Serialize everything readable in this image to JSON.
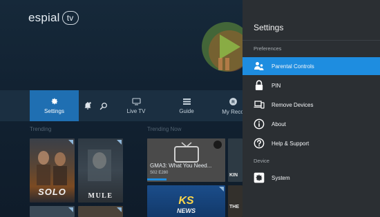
{
  "app": {
    "logo_text": "espial",
    "logo_badge": "tv"
  },
  "nav": {
    "settings_label": "Settings",
    "live_tv_label": "Live TV",
    "guide_label": "Guide",
    "recordings_label": "My Reco"
  },
  "rows": {
    "trending_label": "Trending",
    "trending_now_label": "Trending Now"
  },
  "tiles": {
    "solo_title": "SOLO",
    "mule_title": "MULE",
    "news_title": "GMA3: What You Need...",
    "news_sub": "S02 E280",
    "ksg_title": "KS",
    "news_word": "NEWS",
    "kin_text": "KIN",
    "the_text": "THE"
  },
  "settings": {
    "title": "Settings",
    "preferences_label": "Preferences",
    "device_label": "Device",
    "items": [
      {
        "label": "Parental Controls",
        "icon": "parental-controls-icon",
        "selected": true
      },
      {
        "label": "PIN",
        "icon": "lock-icon"
      },
      {
        "label": "Remove Devices",
        "icon": "remove-devices-icon"
      },
      {
        "label": "About",
        "icon": "info-icon"
      },
      {
        "label": "Help & Support",
        "icon": "help-icon"
      }
    ],
    "device_items": [
      {
        "label": "System",
        "icon": "gear-icon"
      }
    ]
  },
  "colors": {
    "accent": "#1e8de0",
    "nav_active": "#1f6fb2",
    "panel_bg": "#2b2f33",
    "app_bg": "#122232"
  }
}
